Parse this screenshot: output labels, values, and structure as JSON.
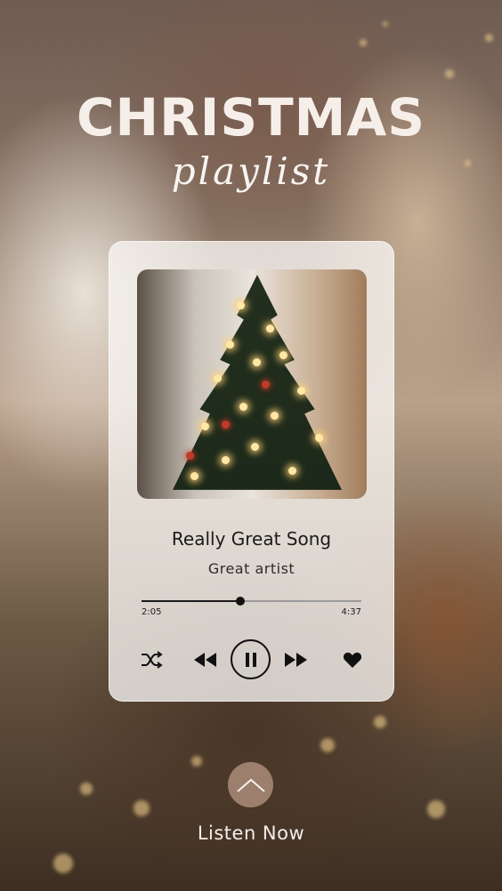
{
  "header": {
    "title": "CHRISTMAS",
    "subtitle": "playlist"
  },
  "player": {
    "song_title": "Really Great Song",
    "artist": "Great artist",
    "elapsed": "2:05",
    "total": "4:37",
    "progress_fraction": 0.45,
    "state": "playing"
  },
  "controls": {
    "icons": [
      "shuffle-icon",
      "previous-icon",
      "pause-icon",
      "next-icon",
      "heart-icon"
    ]
  },
  "cta": {
    "label": "Listen Now",
    "icon": "chevron-up-icon"
  },
  "colors": {
    "title": "#f6efe9",
    "card": "#f8f6f4",
    "controls": "#111111",
    "cta_button": "#aa8c78"
  }
}
